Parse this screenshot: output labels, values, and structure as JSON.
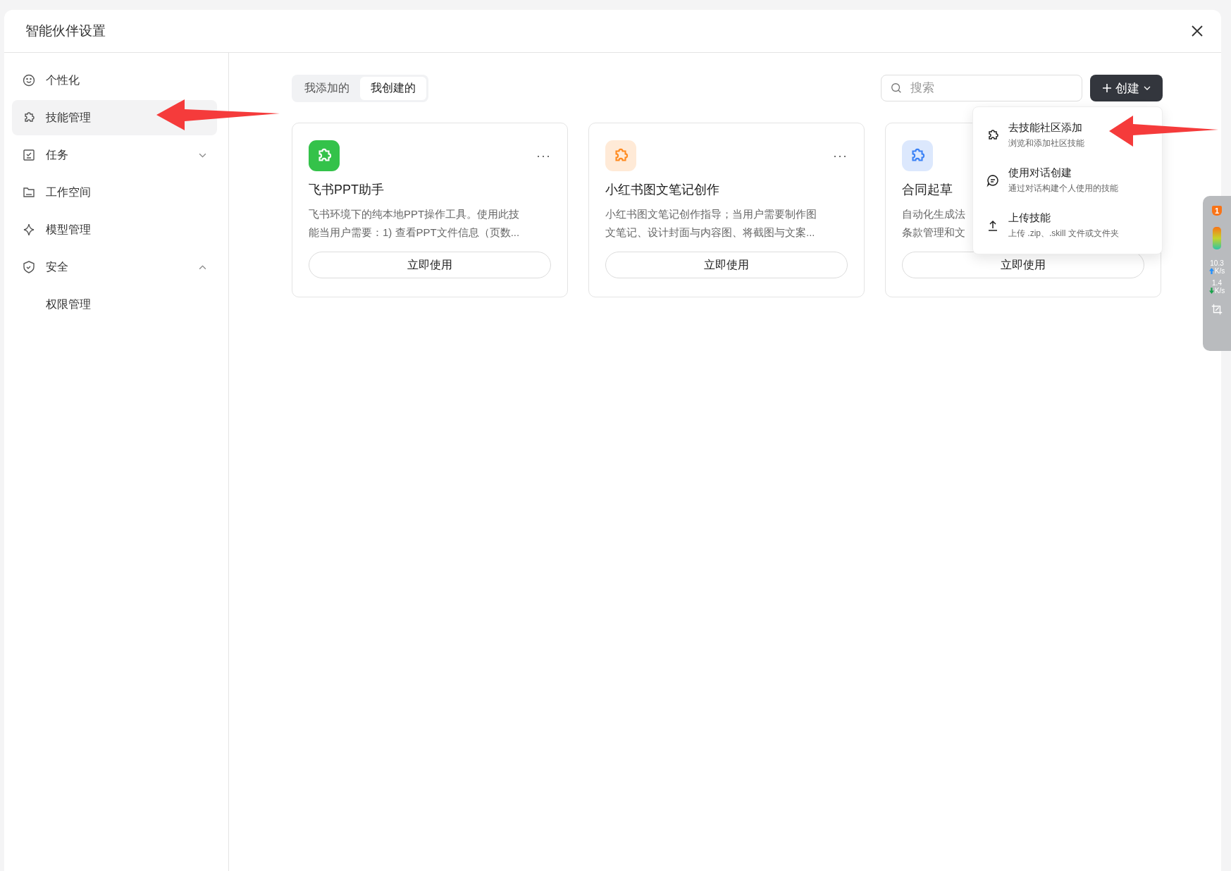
{
  "window": {
    "title": "智能伙伴设置"
  },
  "sidebar": {
    "items": [
      {
        "label": "个性化",
        "selected": false
      },
      {
        "label": "技能管理",
        "selected": true
      },
      {
        "label": "任务",
        "selected": false,
        "expanded": false
      },
      {
        "label": "工作空间",
        "selected": false
      },
      {
        "label": "模型管理",
        "selected": false
      },
      {
        "label": "安全",
        "selected": false,
        "expanded": true,
        "children": [
          {
            "label": "权限管理",
            "selected": false
          }
        ]
      }
    ]
  },
  "tabs": [
    {
      "label": "我添加的",
      "selected": false
    },
    {
      "label": "我创建的",
      "selected": true
    }
  ],
  "search": {
    "placeholder": "搜索"
  },
  "create_button": {
    "label": "创建"
  },
  "cards": [
    {
      "title": "飞书PPT助手",
      "color": "#34c24a",
      "description": [
        "飞书环境下的纯本地PPT操作工具。使用此技",
        "能当用户需要：1) 查看PPT文件信息（页数..."
      ],
      "button": "立即使用",
      "more": "···"
    },
    {
      "title": "小红书图文笔记创作",
      "color": "#ff8a1f",
      "description": [
        "小红书图文笔记创作指导；当用户需要制作图",
        "文笔记、设计封面与内容图、将截图与文案..."
      ],
      "button": "立即使用",
      "more": "···"
    },
    {
      "title": "合同起草",
      "color": "#3b82f6",
      "description": [
        "自动化生成法",
        "条款管理和文"
      ],
      "button": "立即使用"
    }
  ],
  "create_menu": [
    {
      "title": "去技能社区添加",
      "subtitle": "浏览和添加社区技能"
    },
    {
      "title": "使用对话创建",
      "subtitle": "通过对话构建个人使用的技能"
    },
    {
      "title": "上传技能",
      "subtitle": "上传 .zip、.skill 文件或文件夹"
    }
  ],
  "net_monitor": {
    "badge": "1",
    "upload": "10.3",
    "upload_unit": "K/s",
    "download": "1.4",
    "download_unit": "K/s"
  }
}
